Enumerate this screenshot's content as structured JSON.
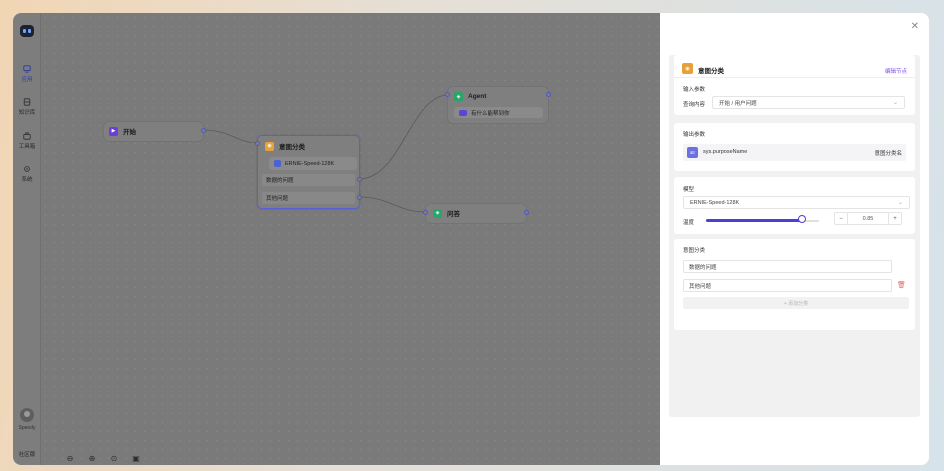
{
  "sidebar": {
    "items": [
      {
        "label": "应用",
        "icon": "app-icon",
        "active": true
      },
      {
        "label": "知识库",
        "icon": "database-icon"
      },
      {
        "label": "工具箱",
        "icon": "toolbox-icon"
      },
      {
        "label": "系统",
        "icon": "gear-icon"
      }
    ],
    "user": "Speedy",
    "workspace": "社区版"
  },
  "canvas": {
    "nodes": {
      "start": {
        "title": "开始",
        "icon": "play-icon",
        "color": "#6a3de0"
      },
      "classifier": {
        "title": "意图分类",
        "icon": "classify-icon",
        "color": "#e8a13a",
        "model": "ERNIE-Speed-128K",
        "classes": [
          "数据的问题",
          "其他问题"
        ]
      },
      "agent": {
        "title": "Agent",
        "icon": "agent-icon",
        "color": "#27a56b",
        "input_chip": "有什么能帮到你"
      },
      "qa": {
        "title": "问答",
        "icon": "qa-icon",
        "color": "#27a56b"
      }
    },
    "zoom_controls": [
      "zoom-out-icon",
      "zoom-in-icon",
      "fit-view-icon",
      "lock-icon"
    ]
  },
  "panel": {
    "title": "意图分类",
    "rename_link": "编辑节点",
    "input": {
      "section": "输入参数",
      "query_label": "查询内容",
      "query_value": "开始 / 用户问题"
    },
    "output": {
      "section": "输出参数",
      "var_badge": "str",
      "var_name": "sys.purposeName",
      "var_desc": "意图分类名"
    },
    "model": {
      "section": "模型",
      "name": "ERNIE-Speed-128K",
      "temp_label": "温度",
      "temp_value": "0.85",
      "temp_fraction": 0.85
    },
    "intents": {
      "section": "意图分类",
      "items": [
        "数据的问题",
        "其他问题"
      ],
      "add_label": "+ 添加分类"
    }
  },
  "colors": {
    "accent": "#4c3fd6",
    "link": "#7b4de8",
    "delete": "#e26a6a"
  }
}
